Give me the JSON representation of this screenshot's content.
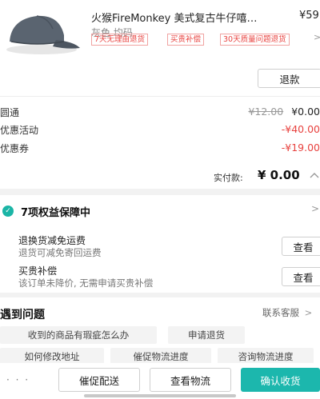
{
  "product": {
    "title": "火猴FireMonkey 美式复古牛仔嘻…",
    "price": "¥59",
    "spec": "灰色 均码",
    "tags": [
      "7天无理由退货",
      "买贵补偿",
      "30天质量问题退货"
    ]
  },
  "actions": {
    "refund_label": "退款"
  },
  "price_rows": [
    {
      "label": "圆通",
      "original": "¥12.00",
      "value": "¥0.00"
    },
    {
      "label": "优惠活动",
      "value": "-¥40.00"
    },
    {
      "label": "优惠券",
      "value": "-¥19.00"
    }
  ],
  "payment": {
    "label": "实付款:",
    "value": "¥ 0.00"
  },
  "rights": {
    "title": "7项权益保障中",
    "items": [
      {
        "title": "退换货减免运费",
        "subtitle": "退货可减免寄回运费",
        "button": "查看"
      },
      {
        "title": "买贵补偿",
        "subtitle": "该订单未降价, 无需申请买贵补偿",
        "button": "查看"
      }
    ]
  },
  "help": {
    "title": "遇到问题",
    "link": "联系客服",
    "chips": [
      "收到的商品有瑕疵怎么办",
      "申请退货",
      "如何修改地址",
      "催促物流进度",
      "咨询物流进度"
    ]
  },
  "bottom_bar": {
    "more": "· · ·",
    "buttons": [
      "催促配送",
      "查看物流",
      "确认收货"
    ]
  },
  "colors": {
    "accent": "#1cb7ad",
    "discount": "#e8423f"
  }
}
